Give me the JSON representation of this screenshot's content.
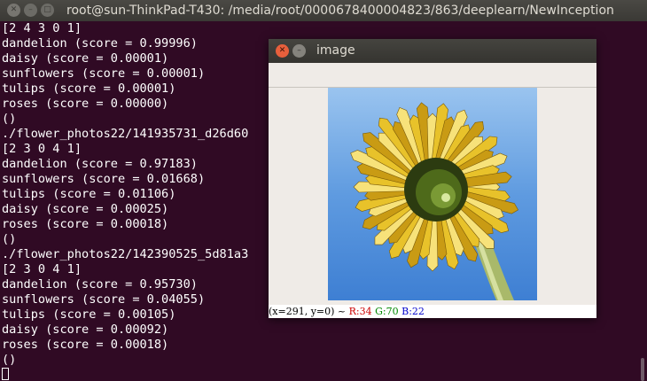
{
  "terminal": {
    "title": "root@sun-ThinkPad-T430: /media/root/0000678400004823/863/deeplearn/NewInception",
    "lines": [
      "[2 4 3 0 1]",
      "dandelion (score = 0.99996)",
      "daisy (score = 0.00001)",
      "sunflowers (score = 0.00001)",
      "tulips (score = 0.00001)",
      "roses (score = 0.00000)",
      "()",
      "./flower_photos22/141935731_d26d60",
      "[2 3 0 4 1]",
      "dandelion (score = 0.97183)",
      "sunflowers (score = 0.01668)",
      "tulips (score = 0.01106)",
      "daisy (score = 0.00025)",
      "roses (score = 0.00018)",
      "()",
      "./flower_photos22/142390525_5d81a3",
      "[2 3 0 4 1]",
      "dandelion (score = 0.95730)",
      "sunflowers (score = 0.04055)",
      "tulips (score = 0.00105)",
      "daisy (score = 0.00092)",
      "roses (score = 0.00018)",
      "()"
    ]
  },
  "image_window": {
    "title": "image",
    "status": {
      "coords": "(x=291, y=0) ~",
      "r": "R:34",
      "g": "G:70",
      "b": "B:22"
    }
  },
  "colors": {
    "terminal_bg": "#300a24",
    "status_r": "#cc0000",
    "status_g": "#008800",
    "status_b": "#0000cc"
  },
  "icons": [
    "close-icon",
    "minimize-icon",
    "maximize-icon"
  ]
}
